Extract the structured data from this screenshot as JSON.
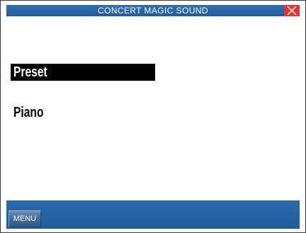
{
  "titlebar": {
    "title": "CONCERT MAGIC SOUND",
    "close_icon": "close-x-icon",
    "close_color": "#e8332f",
    "bar_color": "#205d9e"
  },
  "main": {
    "selected_item": "Preset",
    "sound_name": "Piano"
  },
  "bottombar": {
    "menu_label": "MENU"
  }
}
